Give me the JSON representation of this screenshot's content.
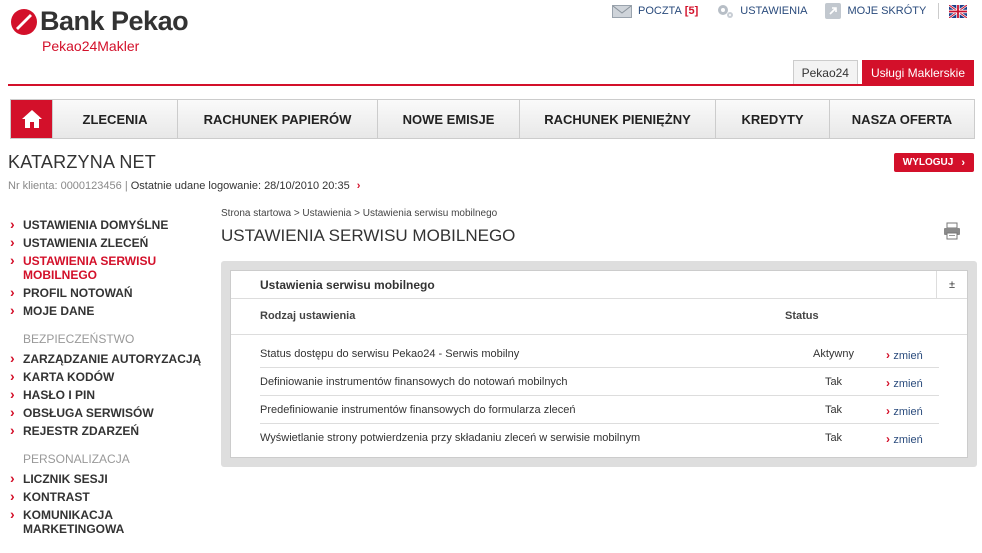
{
  "brand": {
    "title": "Bank Pekao",
    "subtitle": "Pekao24Makler"
  },
  "toplinks": {
    "mail_label": "POCZTA",
    "mail_count": "[5]",
    "settings_label": "USTAWIENIA",
    "shortcuts_label": "MOJE SKRÓTY"
  },
  "tabs": [
    "Pekao24",
    "Usługi Maklerskie"
  ],
  "nav": [
    "ZLECENIA",
    "RACHUNEK PAPIERÓW",
    "NOWE EMISJE",
    "RACHUNEK PIENIĘŻNY",
    "KREDYTY",
    "NASZA OFERTA"
  ],
  "user": {
    "name": "KATARZYNA NET",
    "logout_label": "WYLOGUJ",
    "client_label": "Nr klienta: 0000123456",
    "last_login_label": "Ostatnie udane logowanie:",
    "last_login_value": "28/10/2010 20:35"
  },
  "sidebar": {
    "group1": [
      "USTAWIENIA DOMYŚLNE",
      "USTAWIENIA ZLECEŃ",
      "USTAWIENIA SERWISU MOBILNEGO",
      "PROFIL NOTOWAŃ",
      "MOJE DANE"
    ],
    "heading2": "BEZPIECZEŃSTWO",
    "group2": [
      "ZARZĄDZANIE AUTORYZACJĄ",
      "KARTA KODÓW",
      "HASŁO I PIN",
      "OBSŁUGA SERWISÓW",
      "REJESTR ZDARZEŃ"
    ],
    "heading3": "PERSONALIZACJA",
    "group3": [
      "LICZNIK SESJI",
      "KONTRAST",
      "KOMUNIKACJA MARKETINGOWA"
    ]
  },
  "content": {
    "breadcrumb": "Strona startowa > Ustawienia > Ustawienia serwisu mobilnego",
    "title": "USTAWIENIA SERWISU MOBILNEGO",
    "panel_title": "Ustawienia serwisu mobilnego",
    "collapse_glyph": "±",
    "col_setting": "Rodzaj ustawienia",
    "col_status": "Status",
    "rows": [
      {
        "name": "Status dostępu do serwisu Pekao24 - Serwis mobilny",
        "status": "Aktywny",
        "action": "zmień"
      },
      {
        "name": "Definiowanie instrumentów finansowych do notowań mobilnych",
        "status": "Tak",
        "action": "zmień"
      },
      {
        "name": "Predefiniowanie instrumentów finansowych do formularza zleceń",
        "status": "Tak",
        "action": "zmień"
      },
      {
        "name": "Wyświetlanie strony potwierdzenia przy składaniu zleceń w serwisie mobilnym",
        "status": "Tak",
        "action": "zmień"
      }
    ]
  },
  "colors": {
    "accent": "#d3102a",
    "link": "#2a4b7c"
  },
  "icons": [
    "home-icon",
    "mail-icon",
    "gear-icon",
    "shortcut-icon",
    "uk-flag-icon",
    "print-icon"
  ]
}
